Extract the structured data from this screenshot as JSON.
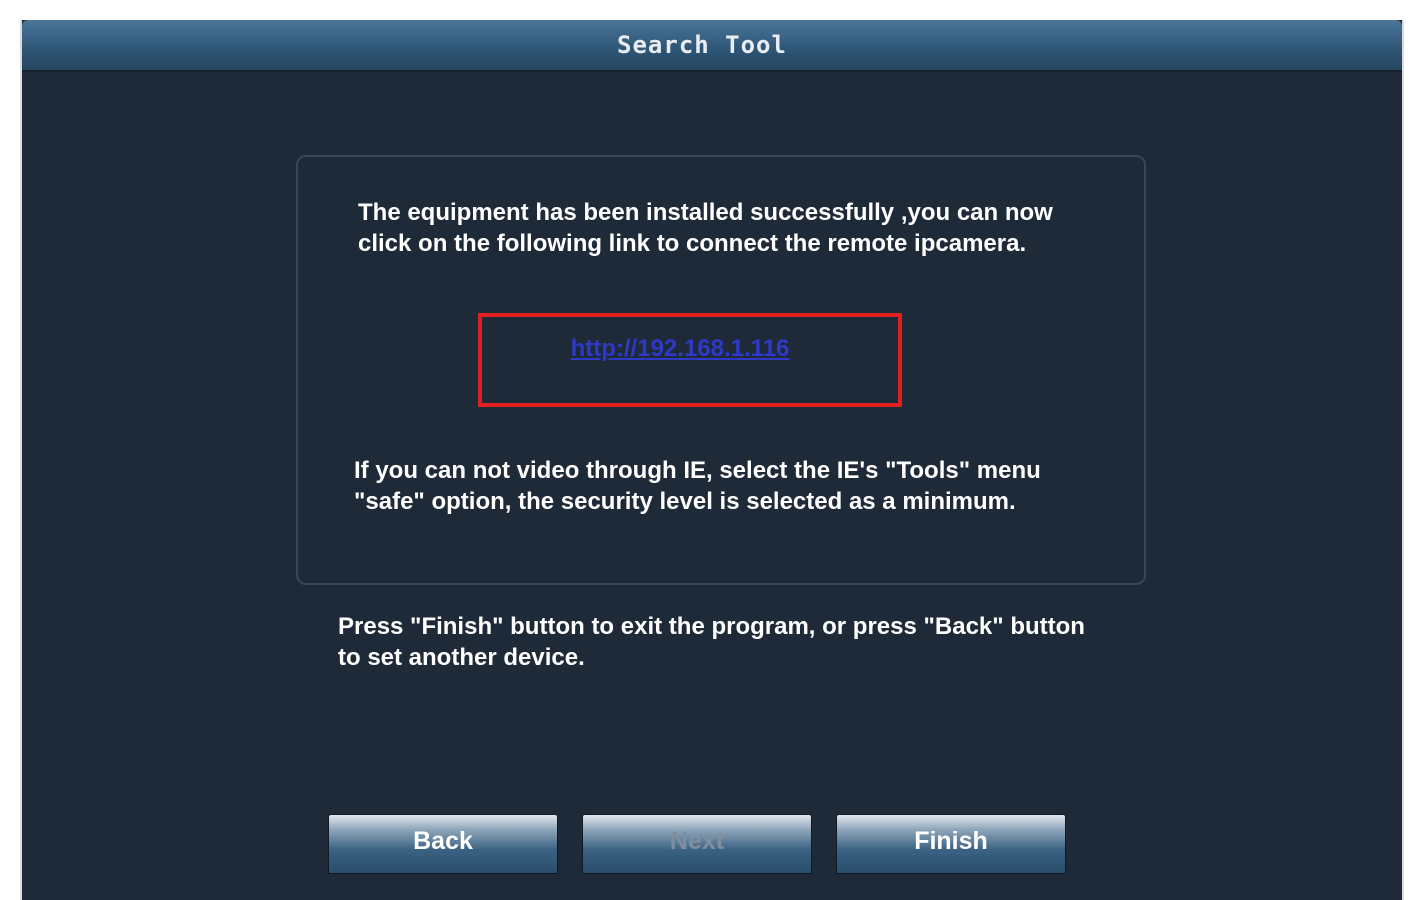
{
  "window": {
    "title": "Search Tool"
  },
  "content": {
    "installed_message": "The equipment has been installed successfully ,you can now click on the following link to connect the remote ipcamera.",
    "camera_link": "http://192.168.1.116",
    "ie_message": "If you can not video through IE, select the IE's \"Tools\" menu  \"safe\" option, the security level is selected as a minimum.",
    "finish_message": "Press \"Finish\" button to exit the program, or press \"Back\" button to set another device."
  },
  "buttons": {
    "back": "Back",
    "next": "Next",
    "finish": "Finish"
  },
  "colors": {
    "background": "#1e2a38",
    "highlight_frame": "#e01f1f",
    "link": "#2f39c8",
    "disabled_text": "#7f8fa0"
  }
}
